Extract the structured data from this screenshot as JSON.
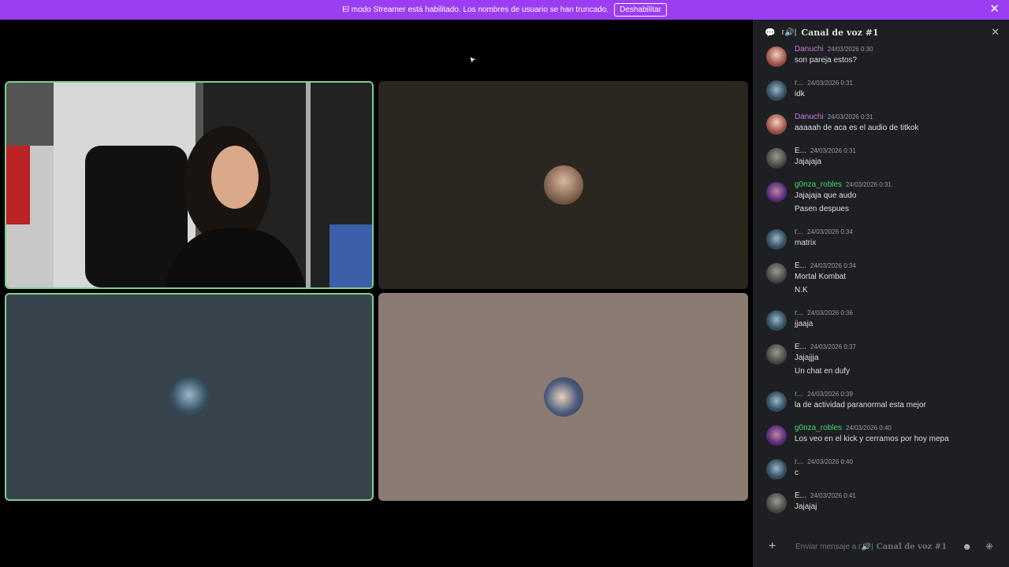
{
  "banner": {
    "text": "El modo Streamer está habilitado. Los nombres de usuario se han truncado.",
    "button_label": "Deshabilitar",
    "close_glyph": "✕"
  },
  "stage": {
    "cursor_glyph": "➤",
    "tiles": [
      {
        "kind": "video",
        "speaking": true,
        "background": "#3a3a3a"
      },
      {
        "kind": "avatar",
        "speaking": false,
        "background": "#2a2721"
      },
      {
        "kind": "avatar",
        "speaking": true,
        "background": "#37444d"
      },
      {
        "kind": "avatar",
        "speaking": false,
        "background": "#8c7b72"
      }
    ]
  },
  "sidebar": {
    "bubble_icon": "💬",
    "channel_icon": "ᴦ🔊|",
    "title": "Canal de voz #1",
    "close_glyph": "✕",
    "messages": [
      {
        "name": "Danuchi",
        "color": "#c27cda",
        "time": "24/03/2026 0:30",
        "lines": [
          "son pareja estos?"
        ]
      },
      {
        "name": "r...",
        "color": "#949ba4",
        "time": "24/03/2026 0:31",
        "lines": [
          "idk"
        ]
      },
      {
        "name": "Danuchi",
        "color": "#c27cda",
        "time": "24/03/2026 0:31",
        "lines": [
          "aaaaah de aca es el audio de titkok"
        ]
      },
      {
        "name": "E...",
        "color": "#dbdee1",
        "time": "24/03/2026 0:31",
        "lines": [
          "Jajajaja"
        ]
      },
      {
        "name": "g0nza_robles",
        "color": "#43d66d",
        "time": "24/03/2026 0:31",
        "lines": [
          "Jajajaja que audo",
          "Pasen despues"
        ]
      },
      {
        "name": "r...",
        "color": "#949ba4",
        "time": "24/03/2026 0:34",
        "lines": [
          "matrix"
        ]
      },
      {
        "name": "E...",
        "color": "#dbdee1",
        "time": "24/03/2026 0:34",
        "lines": [
          "Mortal Kombat",
          "N.K"
        ]
      },
      {
        "name": "r...",
        "color": "#949ba4",
        "time": "24/03/2026 0:36",
        "lines": [
          "jjaaja"
        ]
      },
      {
        "name": "E...",
        "color": "#dbdee1",
        "time": "24/03/2026 0:37",
        "lines": [
          "Jajajjja",
          "Un chat en dufy"
        ]
      },
      {
        "name": "r...",
        "color": "#949ba4",
        "time": "24/03/2026 0:39",
        "lines": [
          "la de actividad paranormal esta mejor"
        ]
      },
      {
        "name": "g0nza_robles",
        "color": "#43d66d",
        "time": "24/03/2026 0:40",
        "lines": [
          "Los veo en el kick y cerramos por hoy mepa"
        ]
      },
      {
        "name": "r...",
        "color": "#949ba4",
        "time": "24/03/2026 0:40",
        "lines": [
          "c"
        ]
      },
      {
        "name": "E...",
        "color": "#dbdee1",
        "time": "24/03/2026 0:41",
        "lines": [
          "Jajajaj"
        ]
      }
    ],
    "composer": {
      "plus_glyph": "+",
      "placeholder_prefix": "Enviar mensaje a ᴦ🔊|",
      "placeholder_channel": "Canal de voz #1",
      "emoji_glyph": "☻",
      "apps_glyph": "⁜"
    }
  }
}
